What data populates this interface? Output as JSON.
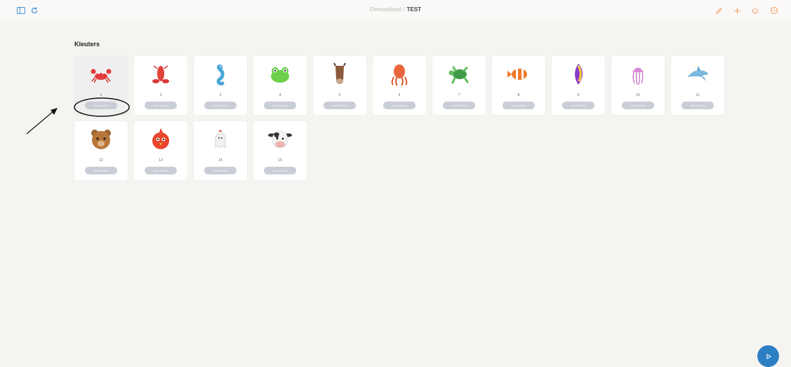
{
  "header": {
    "breadcrumb_parent": "Demoschool",
    "breadcrumb_separator": "/",
    "breadcrumb_current": "TEST"
  },
  "group": {
    "title": "Kleuters",
    "button_label": "Aanmelding",
    "cards": [
      {
        "number": "1",
        "icon": "crab-icon",
        "selected": true
      },
      {
        "number": "2",
        "icon": "lobster-icon"
      },
      {
        "number": "3",
        "icon": "seahorse-icon"
      },
      {
        "number": "4",
        "icon": "frog-icon"
      },
      {
        "number": "5",
        "icon": "horse-icon"
      },
      {
        "number": "6",
        "icon": "squid-icon"
      },
      {
        "number": "7",
        "icon": "turtle-icon"
      },
      {
        "number": "8",
        "icon": "clownfish-icon"
      },
      {
        "number": "9",
        "icon": "tropical-fish-icon"
      },
      {
        "number": "10",
        "icon": "jellyfish-icon"
      },
      {
        "number": "11",
        "icon": "dolphin-icon"
      },
      {
        "number": "12",
        "icon": "bear-icon"
      },
      {
        "number": "13",
        "icon": "bird-icon"
      },
      {
        "number": "14",
        "icon": "ghost-icon"
      },
      {
        "number": "15",
        "icon": "cow-icon"
      }
    ]
  },
  "colors": {
    "background": "#f6f4f1",
    "accent": "#2d7fc4",
    "header_icons": "#f0a06a",
    "pill": "#c9ced6"
  }
}
